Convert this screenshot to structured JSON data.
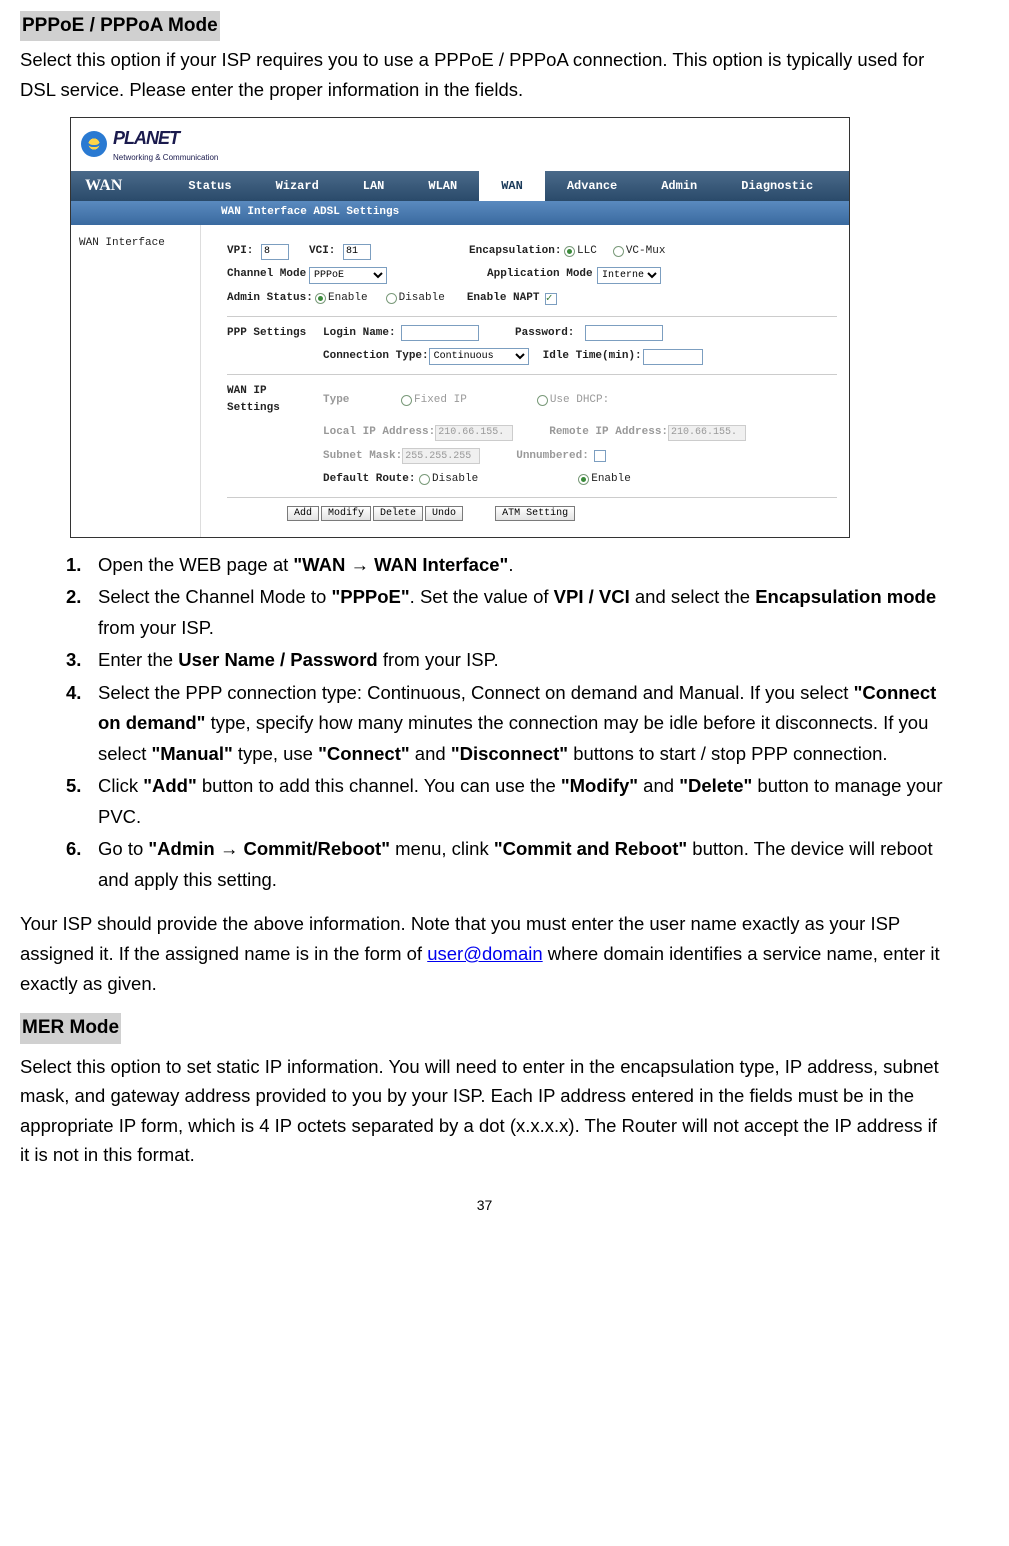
{
  "section1": {
    "title": "PPPoE / PPPoA Mode",
    "intro": "Select this option if your ISP requires you to use a PPPoE / PPPoA connection. This option is typically used for DSL service. Please enter the proper information in the fields."
  },
  "screenshot": {
    "logo_main": "PLANET",
    "logo_sub": "Networking & Communication",
    "nav_title": "WAN",
    "nav": [
      "Status",
      "Wizard",
      "LAN",
      "WLAN",
      "WAN",
      "Advance",
      "Admin",
      "Diagnostic"
    ],
    "subnav": "WAN Interface  ADSL Settings",
    "sidebar": "WAN Interface",
    "row1": {
      "vpi_label": "VPI:",
      "vpi": "8",
      "vci_label": "VCI:",
      "vci": "81",
      "encap_label": "Encapsulation:",
      "llc": "LLC",
      "vcmux": "VC-Mux"
    },
    "row2": {
      "chmode_label": "Channel Mode",
      "chmode": "PPPoE",
      "appmode_label": "Application Mode",
      "appmode": "Internet"
    },
    "row3": {
      "admin_label": "Admin Status:",
      "enable": "Enable",
      "disable": "Disable",
      "napt_label": "Enable NAPT"
    },
    "ppp": {
      "section": "PPP Settings",
      "login_label": "Login Name:",
      "pass_label": "Password:",
      "conn_label": "Connection Type:",
      "conn_val": "Continuous",
      "idle_label": "Idle Time(min):"
    },
    "wanip": {
      "section": "WAN IP Settings",
      "type_label": "Type",
      "fixed": "Fixed IP",
      "dhcp": "Use DHCP:",
      "local_label": "Local IP Address:",
      "local": "210.66.155.",
      "remote_label": "Remote IP Address:",
      "remote": "210.66.155.",
      "subnet_label": "Subnet Mask:",
      "subnet": "255.255.255",
      "unnum_label": "Unnumbered:",
      "defroute_label": "Default Route:",
      "disable": "Disable",
      "enable": "Enable"
    },
    "buttons": {
      "add": "Add",
      "modify": "Modify",
      "delete": "Delete",
      "undo": "Undo",
      "atm": "ATM Setting"
    }
  },
  "steps": [
    {
      "pre": "Open the WEB page at ",
      "b": "\"WAN → WAN Interface\"",
      "post": "."
    },
    {
      "pre": "Select the Channel Mode to ",
      "b": "\"PPPoE\"",
      "mid": ". Set the value of ",
      "b2": "VPI / VCI",
      "mid2": " and select the ",
      "b3": "Encapsulation mode",
      "post": " from your ISP."
    },
    {
      "pre": "Enter the ",
      "b": "User Name / Password",
      "post": " from your ISP."
    },
    {
      "pre": "Select the PPP connection type: Continuous, Connect on demand and Manual. If you select ",
      "b": "\"Connect on demand\"",
      "mid": " type, specify how many minutes the connection may be idle before it disconnects. If you select ",
      "b2": "\"Manual\"",
      "mid2": " type, use ",
      "b3": "\"Connect\"",
      "mid3": " and ",
      "b4": "\"Disconnect\"",
      "post": " buttons to start / stop PPP connection."
    },
    {
      "pre": "Click ",
      "b": "\"Add\"",
      "mid": " button to add this channel. You can use the ",
      "b2": "\"Modify\"",
      "mid2": " and ",
      "b3": "\"Delete\"",
      "post": " button to manage your PVC."
    },
    {
      "pre": "Go to ",
      "b": "\"Admin → Commit/Reboot\"",
      "mid": " menu, clink ",
      "b2": "\"Commit and Reboot\"",
      "post": " button. The device will reboot and apply this setting."
    }
  ],
  "isp_note": {
    "pre": "Your ISP should provide the above information. Note that you must enter the user name exactly as your ISP assigned it. If the assigned name is in the form of ",
    "link": "user@domain",
    "post": " where domain identifies a service name, enter it exactly as given."
  },
  "section2": {
    "title": "MER Mode",
    "body": "Select this option to set static IP information. You will need to enter in the encapsulation type, IP address, subnet mask, and gateway address provided to you by your ISP. Each IP address entered in the fields must be in the appropriate IP form, which is 4 IP octets separated by a dot (x.x.x.x). The Router will not accept the IP address if it is not in this format."
  },
  "pagenum": "37"
}
